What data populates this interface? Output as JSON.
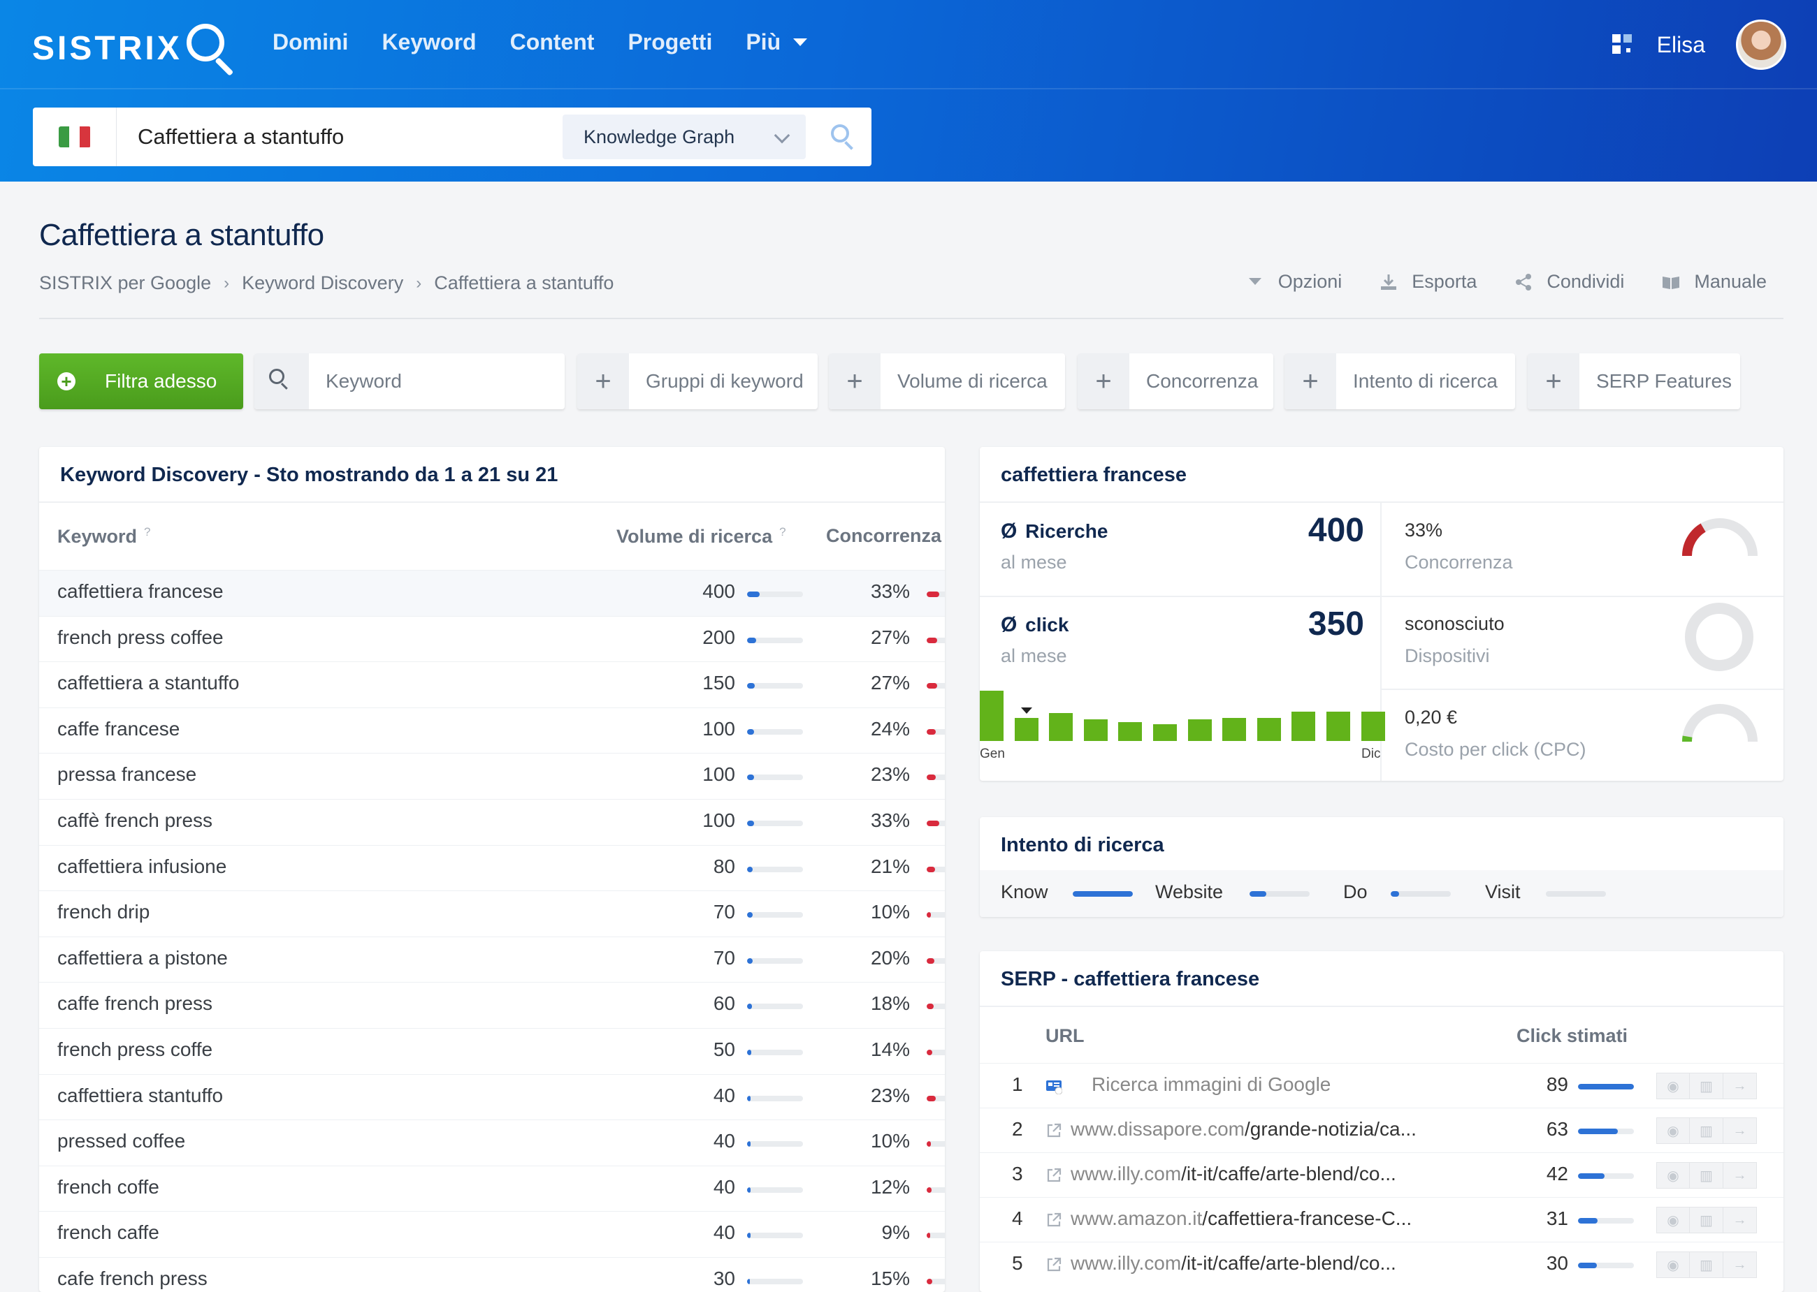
{
  "header": {
    "logo": "SISTRIX",
    "nav": [
      "Domini",
      "Keyword",
      "Content",
      "Progetti",
      "Più"
    ],
    "user_name": "Elisa"
  },
  "search": {
    "value": "Caffettiera a stantuffo",
    "mode": "Knowledge Graph",
    "flag_colors": [
      "#3a9b43",
      "#ffffff",
      "#d7353d"
    ]
  },
  "page": {
    "title": "Caffettiera a stantuffo",
    "breadcrumb": [
      "SISTRIX per Google",
      "Keyword Discovery",
      "Caffettiera a stantuffo"
    ],
    "actions": [
      "Opzioni",
      "Esporta",
      "Condividi",
      "Manuale"
    ]
  },
  "filters": {
    "primary": "Filtra adesso",
    "keyword_placeholder": "Keyword",
    "chips": [
      "Gruppi di keyword",
      "Volume di ricerca",
      "Concorrenza",
      "Intento di ricerca",
      "SERP Features"
    ]
  },
  "keyword_table": {
    "title": "Keyword Discovery - Sto mostrando da 1 a 21 su 21",
    "columns": [
      "Keyword",
      "Volume di ricerca",
      "Concorrenza"
    ],
    "help": "?",
    "rows": [
      {
        "keyword": "caffettiera francese",
        "volume": "400",
        "volume_fill": 0.22,
        "competition": "33%",
        "comp_fill": 0.33
      },
      {
        "keyword": "french press coffee",
        "volume": "200",
        "volume_fill": 0.16,
        "competition": "27%",
        "comp_fill": 0.27
      },
      {
        "keyword": "caffettiera a stantuffo",
        "volume": "150",
        "volume_fill": 0.14,
        "competition": "27%",
        "comp_fill": 0.27
      },
      {
        "keyword": "caffe francese",
        "volume": "100",
        "volume_fill": 0.12,
        "competition": "24%",
        "comp_fill": 0.24
      },
      {
        "keyword": "pressa francese",
        "volume": "100",
        "volume_fill": 0.12,
        "competition": "23%",
        "comp_fill": 0.23
      },
      {
        "keyword": "caffè french press",
        "volume": "100",
        "volume_fill": 0.12,
        "competition": "33%",
        "comp_fill": 0.33
      },
      {
        "keyword": "caffettiera infusione",
        "volume": "80",
        "volume_fill": 0.1,
        "competition": "21%",
        "comp_fill": 0.21
      },
      {
        "keyword": "french drip",
        "volume": "70",
        "volume_fill": 0.1,
        "competition": "10%",
        "comp_fill": 0.1
      },
      {
        "keyword": "caffettiera a pistone",
        "volume": "70",
        "volume_fill": 0.1,
        "competition": "20%",
        "comp_fill": 0.2
      },
      {
        "keyword": "caffe french press",
        "volume": "60",
        "volume_fill": 0.09,
        "competition": "18%",
        "comp_fill": 0.18
      },
      {
        "keyword": "french press coffe",
        "volume": "50",
        "volume_fill": 0.08,
        "competition": "14%",
        "comp_fill": 0.14
      },
      {
        "keyword": "caffettiera stantuffo",
        "volume": "40",
        "volume_fill": 0.06,
        "competition": "23%",
        "comp_fill": 0.23
      },
      {
        "keyword": "pressed coffee",
        "volume": "40",
        "volume_fill": 0.06,
        "competition": "10%",
        "comp_fill": 0.1
      },
      {
        "keyword": "french coffe",
        "volume": "40",
        "volume_fill": 0.06,
        "competition": "12%",
        "comp_fill": 0.12
      },
      {
        "keyword": "french caffe",
        "volume": "40",
        "volume_fill": 0.06,
        "competition": "9%",
        "comp_fill": 0.09
      },
      {
        "keyword": "cafe french press",
        "volume": "30",
        "volume_fill": 0.05,
        "competition": "15%",
        "comp_fill": 0.15
      }
    ]
  },
  "keyword_facts": {
    "title": "caffettiera francese",
    "searches_label": "Ricerche",
    "searches_sub": "al mese",
    "searches_value": "400",
    "clicks_label": "click",
    "clicks_sub": "al mese",
    "clicks_value": "350",
    "competition_value": "33%",
    "competition_label": "Concorrenza",
    "competition_fill": 0.33,
    "devices_value": "sconosciuto",
    "devices_label": "Dispositivi",
    "cpc_value": "0,20 €",
    "cpc_label": "Costo per click (CPC)",
    "cpc_fill": 0.05,
    "colors": {
      "gauge_red": "#c0282c",
      "gauge_green": "#5fb82a",
      "gauge_track": "#e4e5e7",
      "bar_green": "#62b31a"
    },
    "trend": {
      "first_label": "Gen",
      "last_label": "Dic",
      "values": [
        100,
        46,
        55,
        43,
        37,
        34,
        43,
        46,
        46,
        58,
        58,
        58
      ],
      "marker_index": 1
    }
  },
  "intent": {
    "title": "Intento di ricerca",
    "items": [
      {
        "label": "Know",
        "fill": 1.0
      },
      {
        "label": "Website",
        "fill": 0.28
      },
      {
        "label": "Do",
        "fill": 0.14
      },
      {
        "label": "Visit",
        "fill": 0.0
      }
    ]
  },
  "serp": {
    "title": "SERP - caffettiera francese",
    "columns": [
      "URL",
      "Click stimati"
    ],
    "rows": [
      {
        "pos": "1",
        "type": "google-images-icon",
        "domain": "",
        "path": "Ricerca immagini di Google",
        "clicks": "89",
        "fill": 1.0
      },
      {
        "pos": "2",
        "type": "external-link-icon",
        "domain": "www.dissapore.com",
        "path": "/grande-notizia/ca...",
        "clicks": "63",
        "fill": 0.71
      },
      {
        "pos": "3",
        "type": "external-link-icon",
        "domain": "www.illy.com",
        "path": "/it-it/caffe/arte-blend/co...",
        "clicks": "42",
        "fill": 0.47
      },
      {
        "pos": "4",
        "type": "external-link-icon",
        "domain": "www.amazon.it",
        "path": "/caffettiera-francese-C...",
        "clicks": "31",
        "fill": 0.35
      },
      {
        "pos": "5",
        "type": "external-link-icon",
        "domain": "www.illy.com",
        "path": "/it-it/caffe/arte-blend/co...",
        "clicks": "30",
        "fill": 0.34
      }
    ]
  }
}
